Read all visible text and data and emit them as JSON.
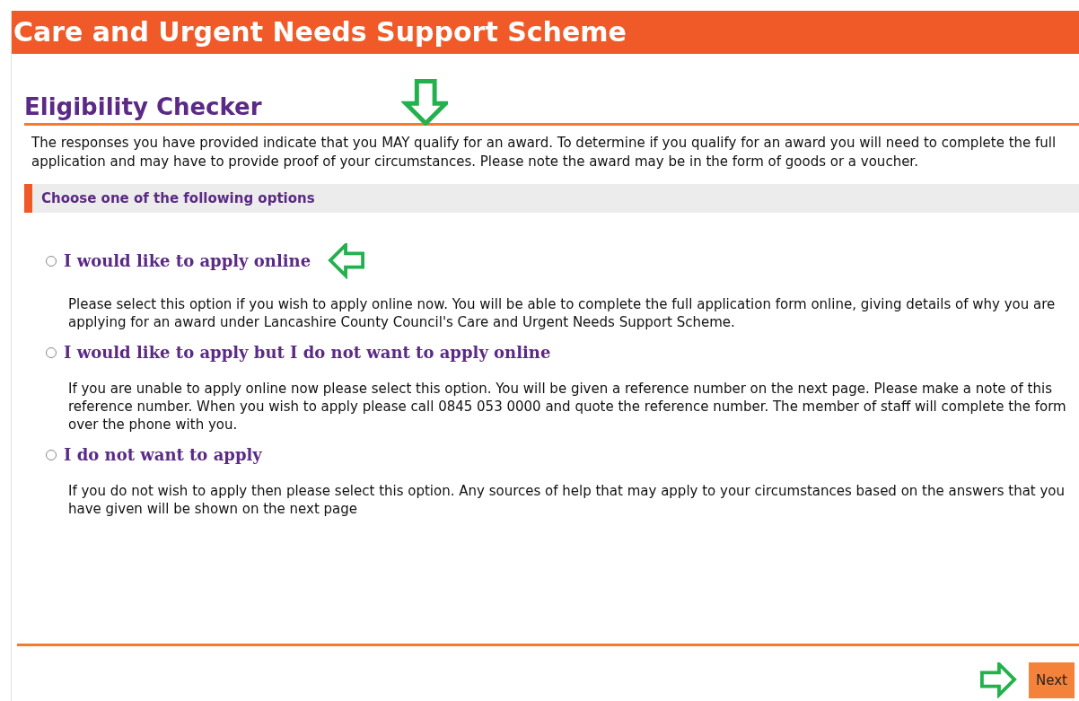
{
  "banner": {
    "title": "Care and Urgent Needs Support Scheme"
  },
  "heading": "Eligibility Checker",
  "intro": "The responses you have provided indicate that you MAY qualify for an award. To determine if you qualify for an award you will need to complete the full application and may have to provide proof of your circumstances. Please note the award may be in the form of goods or a voucher.",
  "section_title": "Choose one of the following options",
  "options": [
    {
      "label": "I would like to apply online",
      "description": "Please select this option if you wish to apply online now. You will be able to complete the full application form online, giving details of why you are applying for an award under Lancashire County Council's Care and Urgent Needs Support Scheme.",
      "selected": false
    },
    {
      "label": "I would like to apply but I do not want to apply online",
      "description": "If you are unable to apply online now please select this option. You will be given a reference number on the next page. Please make a note of this reference number. When you wish to apply please call 0845 053 0000 and quote the reference number. The member of staff will complete the form over the phone with you.",
      "selected": false
    },
    {
      "label": "I do not want to apply",
      "description": "If you do not wish to apply then please select this option. Any sources of help that may apply to your circumstances based on the answers that you have given will be shown on the next page",
      "selected": false
    }
  ],
  "next_button": "Next"
}
